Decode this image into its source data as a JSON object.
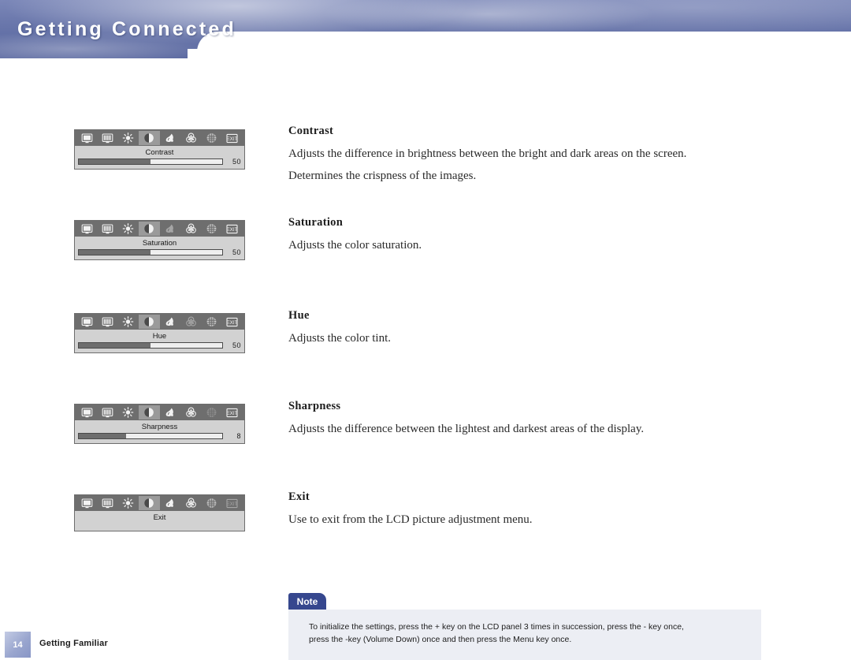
{
  "header": {
    "title": "Getting Connected"
  },
  "sections": [
    {
      "id": "contrast",
      "osd": {
        "label": "Contrast",
        "value": "50",
        "fill_percent": 50,
        "selected_icon_index": 3,
        "dim_icon_index": -1,
        "has_slider": true
      },
      "heading": "Contrast",
      "paragraphs": [
        "Adjusts the difference in brightness between the bright and dark areas on the screen.",
        "Determines the crispness of the images."
      ]
    },
    {
      "id": "saturation",
      "osd": {
        "label": "Saturation",
        "value": "50",
        "fill_percent": 50,
        "selected_icon_index": 3,
        "dim_icon_index": 4,
        "has_slider": true
      },
      "heading": "Saturation",
      "paragraphs": [
        "Adjusts the color saturation."
      ]
    },
    {
      "id": "hue",
      "osd": {
        "label": "Hue",
        "value": "50",
        "fill_percent": 50,
        "selected_icon_index": 3,
        "dim_icon_index": 5,
        "has_slider": true
      },
      "heading": "Hue",
      "paragraphs": [
        "Adjusts the color tint."
      ]
    },
    {
      "id": "sharpness",
      "osd": {
        "label": "Sharpness",
        "value": "8",
        "fill_percent": 33,
        "selected_icon_index": 3,
        "dim_icon_index": 6,
        "has_slider": true
      },
      "heading": "Sharpness",
      "paragraphs": [
        "Adjusts the difference between the lightest and darkest areas of the display."
      ]
    },
    {
      "id": "exit",
      "osd": {
        "label": "Exit",
        "value": "",
        "fill_percent": 0,
        "selected_icon_index": 3,
        "dim_icon_index": 7,
        "has_slider": false
      },
      "heading": "Exit",
      "paragraphs": [
        "Use to exit from the LCD picture adjustment menu."
      ]
    }
  ],
  "osd_icons": [
    "monitor-icon",
    "screen-adjust-icon",
    "brightness-icon",
    "contrast-icon",
    "saturation-icon",
    "hue-icon",
    "sharpness-icon",
    "exit-icon"
  ],
  "note": {
    "tab_label": "Note",
    "lines": [
      "To initialize the settings, press the + key on the LCD panel 3 times in succession, press the - key once,",
      "press the -key (Volume Down) once and then press the Menu key once."
    ]
  },
  "footer": {
    "page_number": "14",
    "chapter": "Getting Familiar"
  },
  "colors": {
    "banner": "#6c79ad",
    "note_tab": "#36478e",
    "note_body": "#eceef4",
    "osd_bar": "#6e6e6e",
    "osd_bg": "#d2d2d2"
  }
}
